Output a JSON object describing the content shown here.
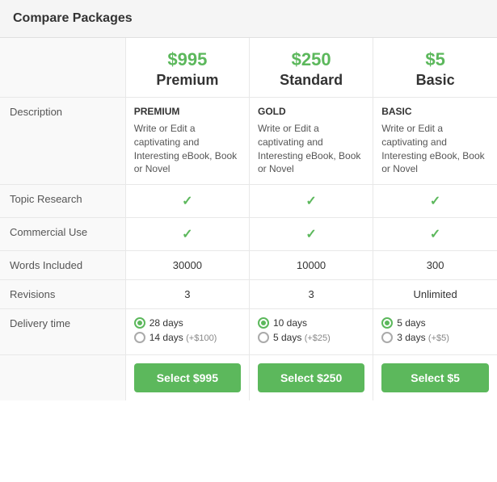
{
  "header": {
    "title": "Compare Packages"
  },
  "packages": [
    {
      "price": "$995",
      "name": "Premium",
      "desc_title": "PREMIUM",
      "desc_text": "Write or Edit a captivating and Interesting eBook, Book or Novel",
      "topic_research": true,
      "commercial_use": true,
      "words_included": "30000",
      "revisions": "3",
      "delivery_options": [
        {
          "label": "28 days",
          "extra": "",
          "selected": true
        },
        {
          "label": "14 days",
          "extra": "(+$100)",
          "selected": false
        }
      ],
      "button_label": "Select $995"
    },
    {
      "price": "$250",
      "name": "Standard",
      "desc_title": "GOLD",
      "desc_text": "Write or Edit a captivating and Interesting eBook, Book or Novel",
      "topic_research": true,
      "commercial_use": true,
      "words_included": "10000",
      "revisions": "3",
      "delivery_options": [
        {
          "label": "10 days",
          "extra": "",
          "selected": true
        },
        {
          "label": "5 days",
          "extra": "(+$25)",
          "selected": false
        }
      ],
      "button_label": "Select $250"
    },
    {
      "price": "$5",
      "name": "Basic",
      "desc_title": "BASIC",
      "desc_text": "Write or Edit a captivating and Interesting eBook, Book or Novel",
      "topic_research": true,
      "commercial_use": true,
      "words_included": "300",
      "revisions": "Unlimited",
      "delivery_options": [
        {
          "label": "5 days",
          "extra": "",
          "selected": true
        },
        {
          "label": "3 days",
          "extra": "(+$5)",
          "selected": false
        }
      ],
      "button_label": "Select $5"
    }
  ],
  "row_labels": {
    "description": "Description",
    "topic_research": "Topic Research",
    "commercial_use": "Commercial Use",
    "words_included": "Words Included",
    "revisions": "Revisions",
    "delivery_time": "Delivery time"
  }
}
